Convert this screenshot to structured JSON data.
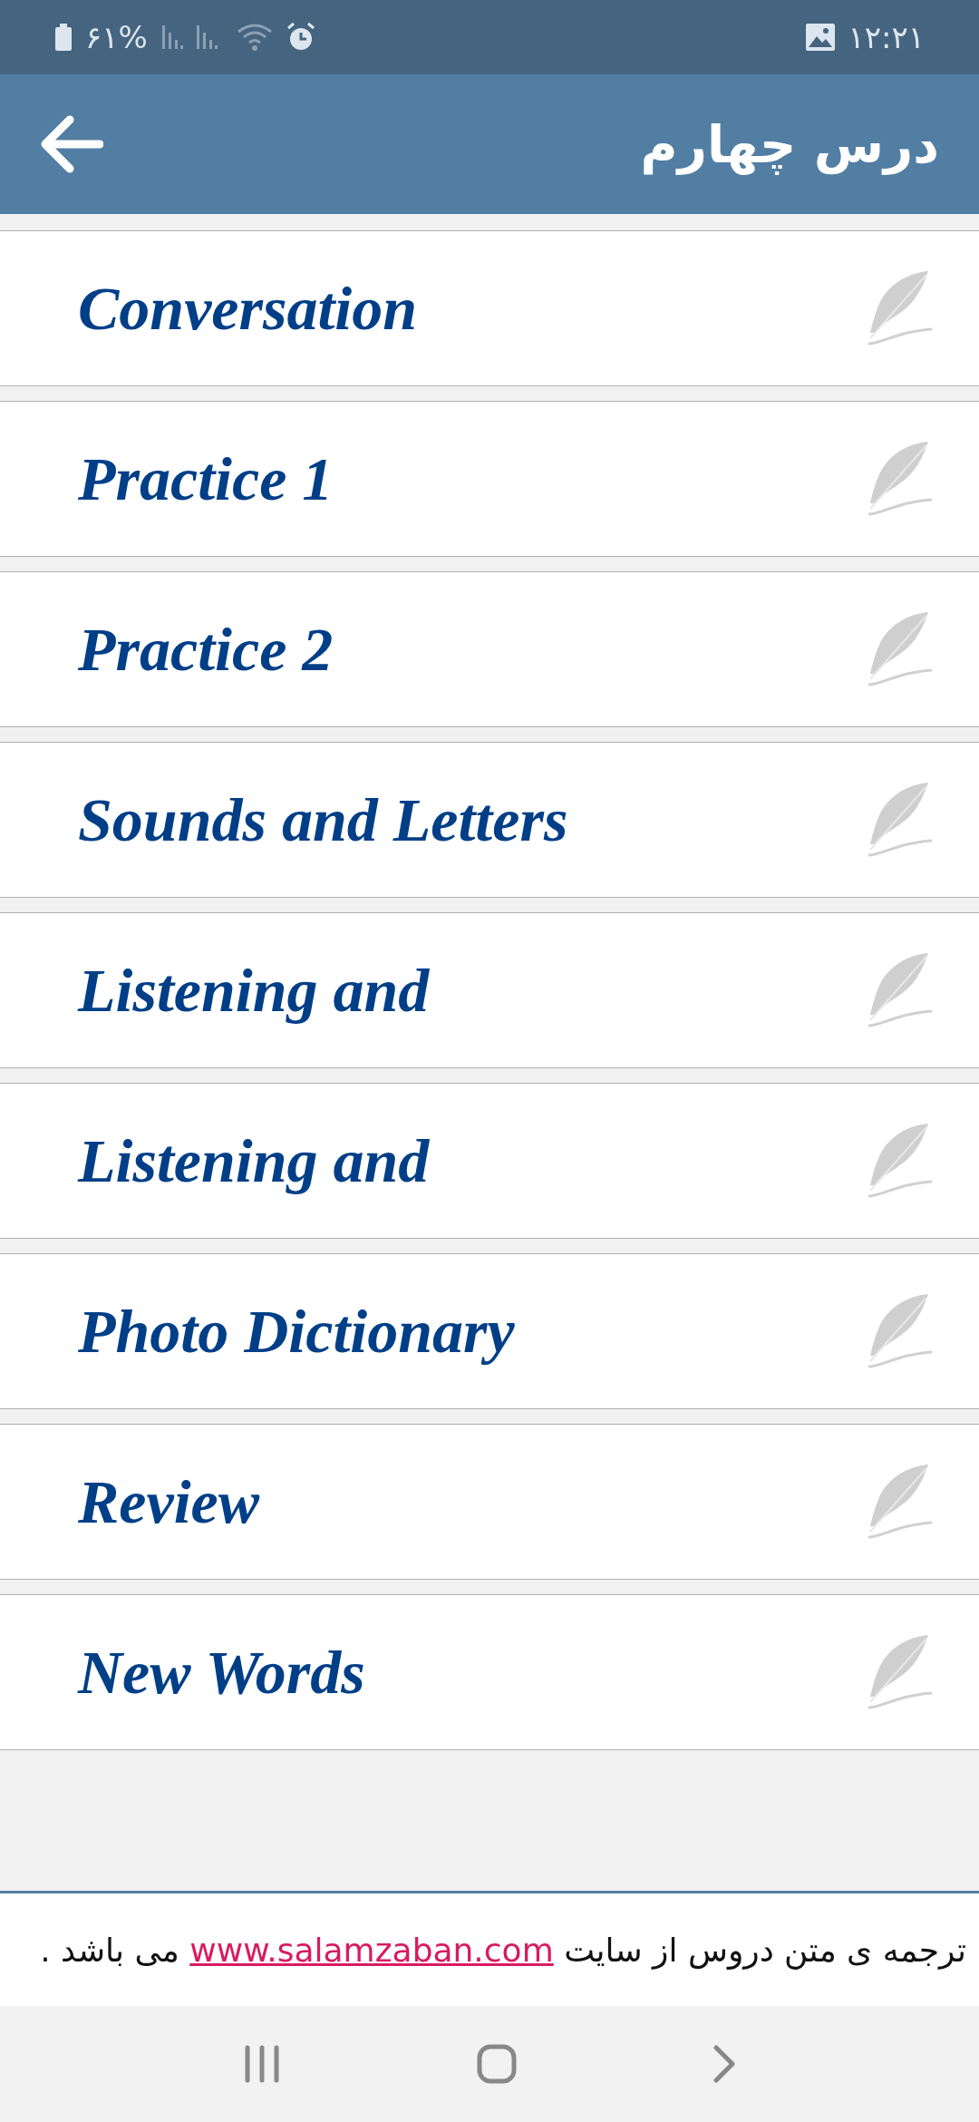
{
  "status_bar": {
    "battery": "۶۱%",
    "time": "۱۲:۲۱"
  },
  "header": {
    "title": "درس چهارم"
  },
  "items": [
    {
      "label": "Conversation"
    },
    {
      "label": "Practice 1"
    },
    {
      "label": "Practice 2"
    },
    {
      "label": "Sounds and Letters"
    },
    {
      "label": "Listening and"
    },
    {
      "label": "Listening and"
    },
    {
      "label": "Photo Dictionary"
    },
    {
      "label": "Review"
    },
    {
      "label": "New Words"
    }
  ],
  "footer": {
    "text_before": "ترجمه ی متن دروس از سایت",
    "link": "www.salamzaban.com",
    "text_after": "می باشد ."
  }
}
